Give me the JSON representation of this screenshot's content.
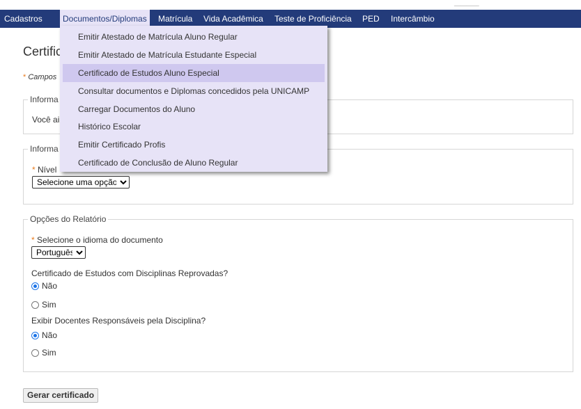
{
  "topstrip": {
    "text": "________"
  },
  "nav": {
    "items": [
      {
        "label": "Cadastros"
      },
      {
        "label": "Documentos/Diplomas"
      },
      {
        "label": "Matrícula"
      },
      {
        "label": "Vida Acadêmica"
      },
      {
        "label": "Teste de Proficiência"
      },
      {
        "label": "PED"
      },
      {
        "label": "Intercâmbio"
      }
    ]
  },
  "dropdown": {
    "items": [
      {
        "label": "Emitir Atestado de Matrícula Aluno Regular"
      },
      {
        "label": "Emitir Atestado de Matrícula Estudante Especial"
      },
      {
        "label": "Certificado de Estudos Aluno Especial"
      },
      {
        "label": "Consultar documentos e Diplomas concedidos pela UNICAMP"
      },
      {
        "label": "Carregar Documentos do Aluno"
      },
      {
        "label": "Histórico Escolar"
      },
      {
        "label": "Emitir Certificado Profis"
      },
      {
        "label": "Certificado de Conclusão de Aluno Regular"
      }
    ]
  },
  "page": {
    "title": "Certific",
    "required_note": "Campos",
    "required_star": "*"
  },
  "section1": {
    "legend": "Informa",
    "message": "Você ai"
  },
  "section2": {
    "legend": "Informa",
    "field_label": "Nível",
    "select_value": "Selecione uma opção"
  },
  "section3": {
    "legend": "Opções do Relatório",
    "language_label": "Selecione o idioma do documento",
    "language_value": "Português",
    "q1": "Certificado de Estudos com Disciplinas Reprovadas?",
    "q1_no": "Não",
    "q1_yes": "Sim",
    "q2": "Exibir Docentes Responsáveis pela Disciplina?",
    "q2_no": "Não",
    "q2_yes": "Sim"
  },
  "actions": {
    "generate_label": "Gerar certificado"
  },
  "colors": {
    "navbar": "#233b7a",
    "dropdown_bg": "#e7e3f7",
    "dropdown_hover": "#cfc8ef",
    "required_star": "#e87a1c",
    "radio_checked": "#1a73e8",
    "success_text": "#2a7a1f"
  }
}
